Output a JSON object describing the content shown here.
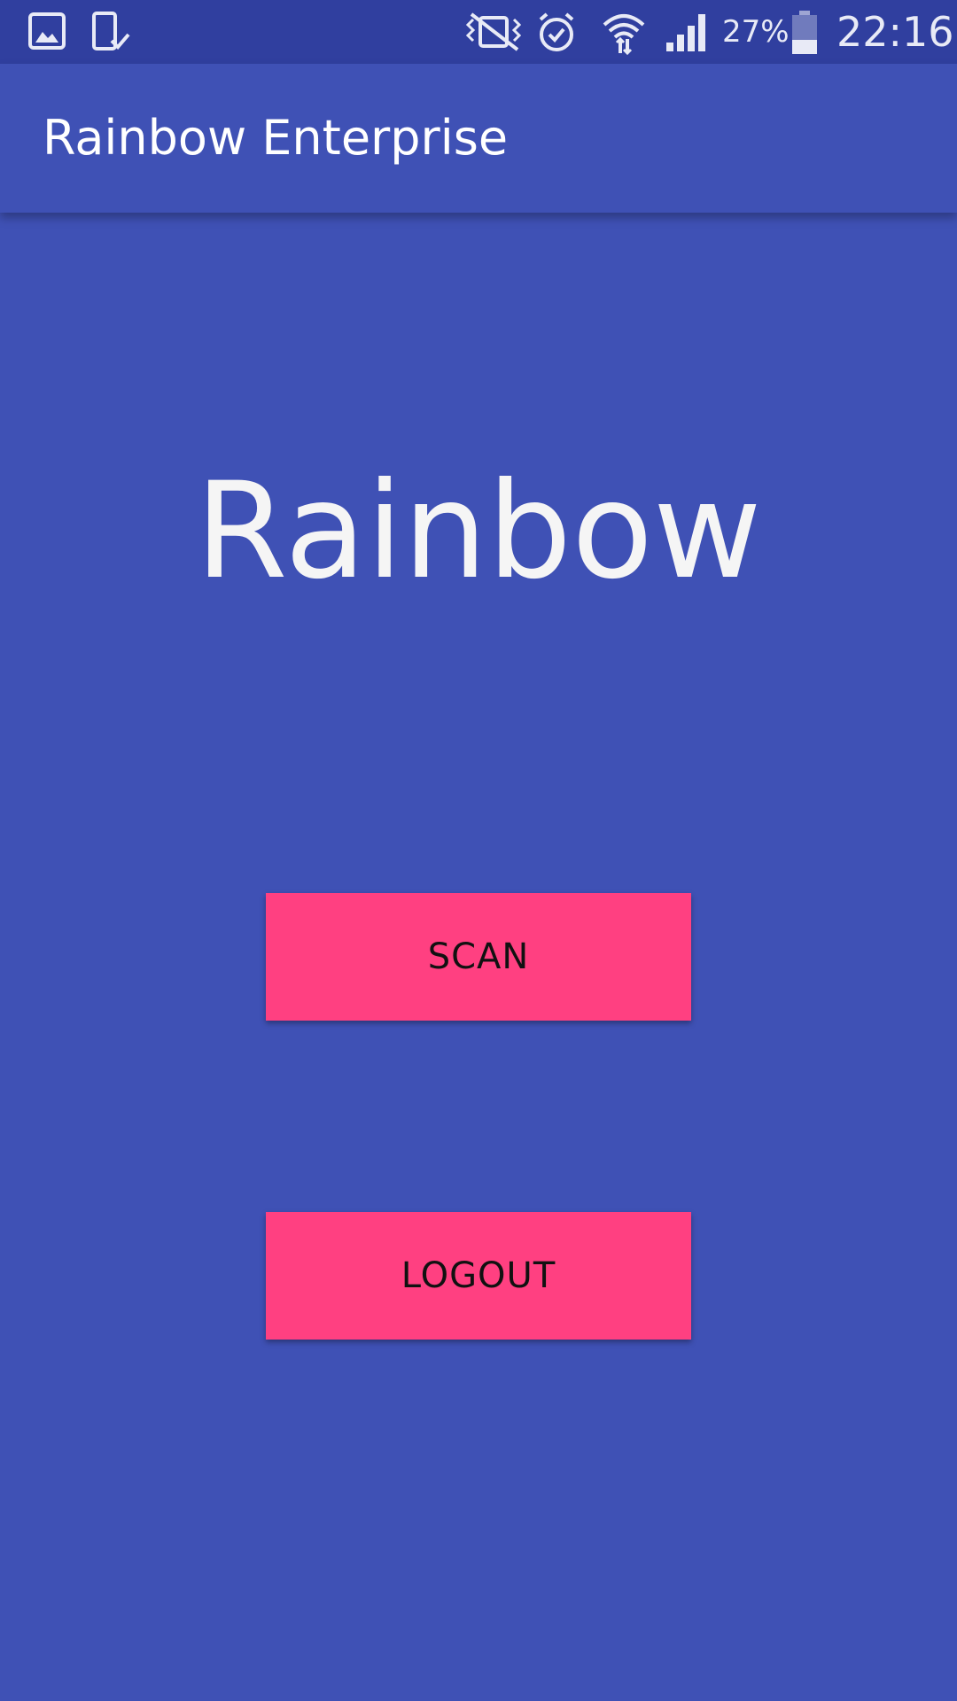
{
  "status_bar": {
    "icons": [
      "gallery-icon",
      "device-check-icon",
      "vibrate-mute-icon",
      "alarm-icon",
      "wifi-icon",
      "signal-icon",
      "battery-icon"
    ],
    "battery_percent": "27%",
    "time": "22:16"
  },
  "app_bar": {
    "title": "Rainbow Enterprise"
  },
  "main": {
    "hero_text": "Rainbow",
    "scan_label": "SCAN",
    "logout_label": "LOGOUT"
  },
  "colors": {
    "primary": "#3F51B5",
    "primary_dark": "#303F9F",
    "accent": "#FF4081"
  }
}
